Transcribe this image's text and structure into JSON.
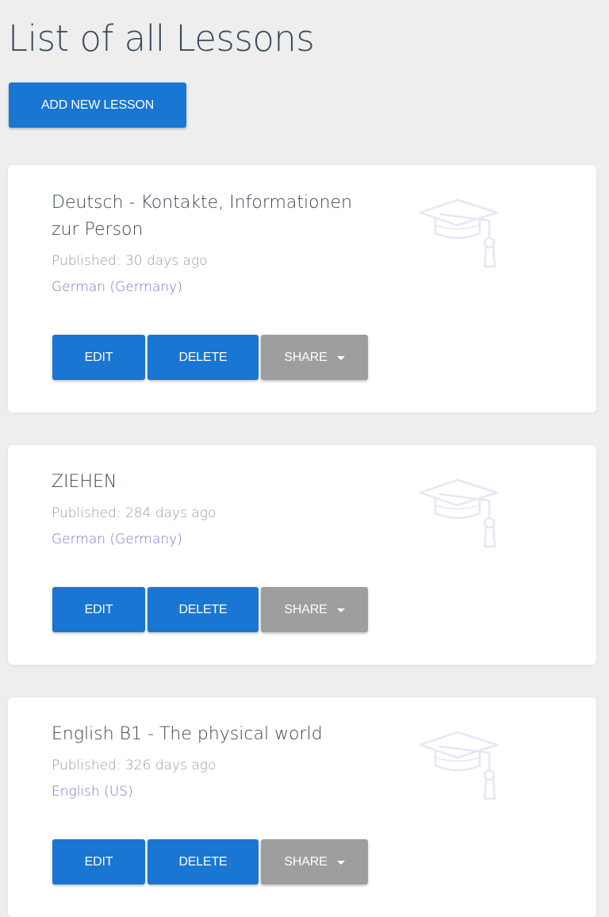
{
  "page": {
    "title": "List of all Lessons",
    "add_button_label": "ADD NEW LESSON"
  },
  "colors": {
    "background": "#eeeeee",
    "primary": "#1976d2",
    "share": "#9e9e9e",
    "language_link": "#7474cc",
    "icon": "#e6e6f6"
  },
  "lessons": [
    {
      "title": "Deutsch - Kontakte, Informationen zur Person",
      "published": "Published: 30 days ago",
      "language": "German (Germany)",
      "icon": "graduation-cap-icon",
      "edit_label": "EDIT",
      "delete_label": "DELETE",
      "share_label": "SHARE"
    },
    {
      "title": "ZIEHEN",
      "published": "Published: 284 days ago",
      "language": "German (Germany)",
      "icon": "graduation-cap-icon",
      "edit_label": "EDIT",
      "delete_label": "DELETE",
      "share_label": "SHARE"
    },
    {
      "title": "English B1 - The physical world",
      "published": "Published: 326 days ago",
      "language": "English (US)",
      "icon": "graduation-cap-icon",
      "edit_label": "EDIT",
      "delete_label": "DELETE",
      "share_label": "SHARE"
    }
  ]
}
